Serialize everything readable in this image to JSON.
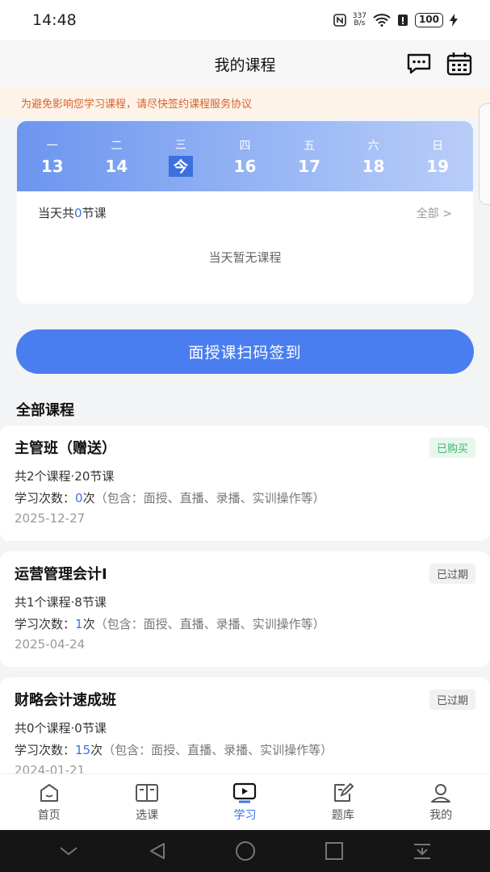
{
  "status_bar": {
    "time": "14:48",
    "net_speed_top": "337",
    "net_speed_bottom": "B/s",
    "battery": "100"
  },
  "header": {
    "title": "我的课程",
    "message_icon": "message-icon",
    "calendar_icon": "calendar-icon"
  },
  "notice": {
    "text": "为避免影响您学习课程，请尽快签约课程服务协议"
  },
  "calendar": {
    "days": [
      {
        "name": "一",
        "num": "13"
      },
      {
        "name": "二",
        "num": "14"
      },
      {
        "name": "三",
        "num": "今"
      },
      {
        "name": "四",
        "num": "16"
      },
      {
        "name": "五",
        "num": "17"
      },
      {
        "name": "六",
        "num": "18"
      },
      {
        "name": "日",
        "num": "19"
      }
    ],
    "count_prefix": "当天共",
    "count_value": "0",
    "count_suffix": "节课",
    "all_link": "全部 >",
    "empty_text": "当天暂无课程"
  },
  "scan_button": {
    "label": "面授课扫码签到"
  },
  "section": {
    "title": "全部课程"
  },
  "courses": [
    {
      "title": "主管班（赠送）",
      "badge": "已购买",
      "info": "共2个课程·20节课",
      "times_prefix": "学习次数：",
      "times_count": "0",
      "times_suffix": "次",
      "times_note": "（包含：面授、直播、录播、实训操作等）",
      "date": "2025-12-27"
    },
    {
      "title": "运营管理会计I",
      "badge": "已过期",
      "info": "共1个课程·8节课",
      "times_prefix": "学习次数：",
      "times_count": "1",
      "times_suffix": "次",
      "times_note": "（包含：面授、直播、录播、实训操作等）",
      "date": "2025-04-24"
    },
    {
      "title": "财略会计速成班",
      "badge": "已过期",
      "info": "共0个课程·0节课",
      "times_prefix": "学习次数：",
      "times_count": "15",
      "times_suffix": "次",
      "times_note": "（包含：面授、直播、录播、实训操作等）",
      "date": "2024-01-21"
    }
  ],
  "tabs": [
    {
      "label": "首页",
      "icon": "home-icon"
    },
    {
      "label": "选课",
      "icon": "book-icon"
    },
    {
      "label": "学习",
      "icon": "play-icon"
    },
    {
      "label": "题库",
      "icon": "edit-icon"
    },
    {
      "label": "我的",
      "icon": "user-icon"
    }
  ],
  "colors": {
    "accent": "#4a7ef0",
    "notice_text": "#d9622b",
    "bought": "#3cb56b"
  }
}
